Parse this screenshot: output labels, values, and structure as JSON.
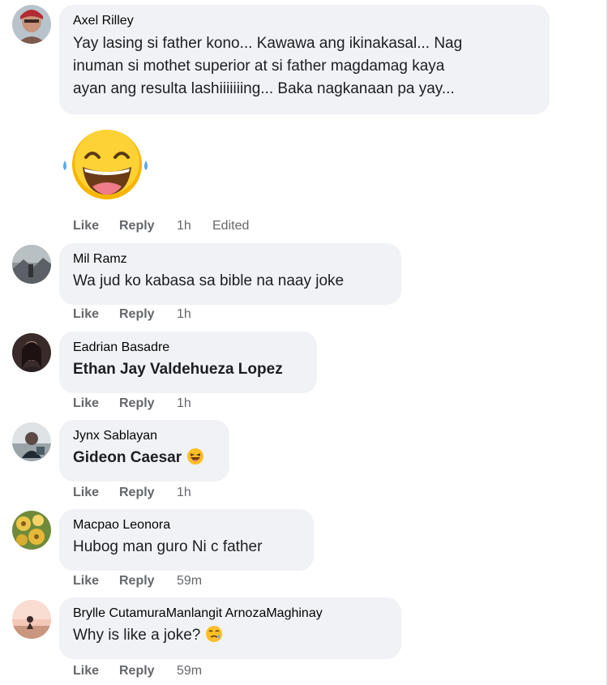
{
  "comments": [
    {
      "author": "Axel Rilley",
      "text_lines": [
        "Yay lasing si father kono... Kawawa ang ikinakasal... Nag",
        "inuman si mothet superior at si father magdamag kaya",
        "ayan ang resulta lashiiiiiiing... Baka nagkanaan pa yay..."
      ],
      "sticker": "laughing-tears-emoji",
      "like": "Like",
      "reply": "Reply",
      "time": "1h",
      "edited": "Edited"
    },
    {
      "author": "Mil Ramz",
      "text": "Wa jud ko kabasa sa bible na naay joke",
      "like": "Like",
      "reply": "Reply",
      "time": "1h"
    },
    {
      "author": "Eadrian Basadre",
      "text": "Ethan Jay Valdehueza Lopez",
      "like": "Like",
      "reply": "Reply",
      "time": "1h"
    },
    {
      "author": "Jynx Sablayan",
      "text": "Gideon Caesar",
      "emoji": "laughing-emoji",
      "like": "Like",
      "reply": "Reply",
      "time": "1h"
    },
    {
      "author": "Macpao Leonora",
      "text": "Hubog man guro Ni c father",
      "like": "Like",
      "reply": "Reply",
      "time": "59m"
    },
    {
      "author": "Brylle CutamuraManlangit ArnozaMaghinay",
      "text": "Why is like a joke?",
      "emoji": "sad-smile-emoji",
      "like": "Like",
      "reply": "Reply",
      "time": "59m"
    }
  ],
  "colors": {
    "bubble": "#f0f2f5",
    "meta": "#65676b",
    "text": "#1c1e21"
  }
}
